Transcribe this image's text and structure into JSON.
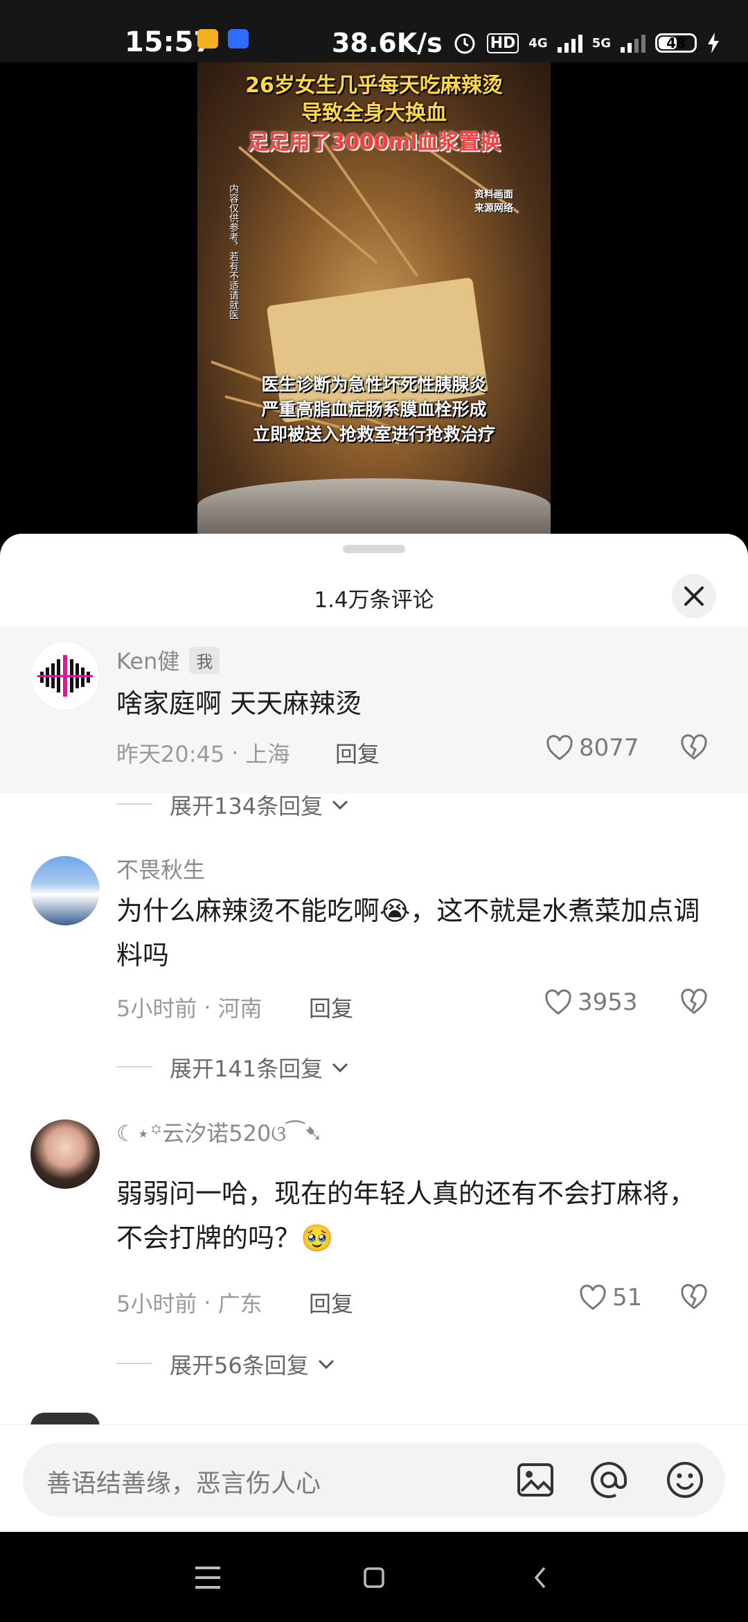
{
  "status_bar": {
    "time": "15:57",
    "net_speed": "38.6K/s",
    "hd_label": "HD",
    "network_4g": "4G",
    "network_5g": "5G",
    "battery": "48"
  },
  "video": {
    "title_lines": [
      "26岁女生几乎每天吃麻辣烫",
      "导致全身大换血",
      "足足用了3000ml血浆置换"
    ],
    "subtitle_lines": [
      "医生诊断为急性坏死性胰腺炎",
      "严重高脂血症肠系膜血栓形成",
      "立即被送入抢救室进行抢救治疗"
    ],
    "side_text": "内容仅供参考，若有不适请就医",
    "source_note": "资料画面\n来源网络"
  },
  "comments_panel": {
    "title": "1.4万条评论",
    "comments": [
      {
        "name": "Ken健",
        "tag": "我",
        "text": "啥家庭啊 天天麻辣烫",
        "time": "昨天20:45",
        "location": "上海",
        "reply_label": "回复",
        "likes": "8077",
        "expand": "展开134条回复"
      },
      {
        "name": "不畏秋生",
        "text": "为什么麻辣烫不能吃啊😭，这不就是水煮菜加点调料吗",
        "time": "5小时前",
        "location": "河南",
        "reply_label": "回复",
        "likes": "3953",
        "expand": "展开141条回复"
      },
      {
        "name": "☾⋆꙳云汐诺520ଓ⁀➷",
        "text": "弱弱问一哈，现在的年轻人真的还有不会打麻将，不会打牌的吗？🥹",
        "time": "5小时前",
        "location": "广东",
        "reply_label": "回复",
        "likes": "51",
        "expand": "展开56条回复"
      }
    ]
  },
  "input": {
    "placeholder": "善语结善缘，恶言伤人心"
  },
  "meta_dot": "·",
  "icons": {
    "close": "close-icon",
    "like": "heart-icon",
    "dislike": "broken-heart-icon",
    "image": "image-icon",
    "mention": "at-icon",
    "emoji": "emoji-icon",
    "expand": "chevron-down-icon"
  }
}
